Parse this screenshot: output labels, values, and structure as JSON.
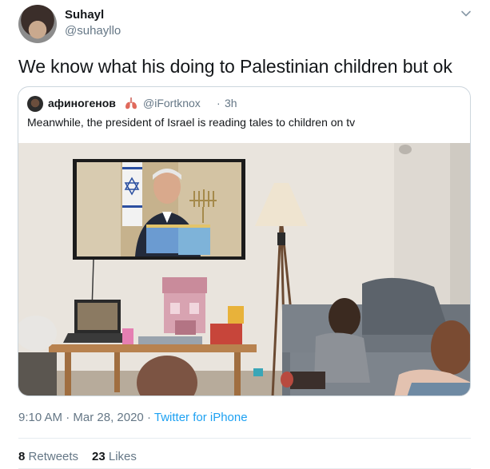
{
  "author": {
    "name": "Suhayl",
    "handle": "@suhayllo"
  },
  "tweet": {
    "text": "We know what his doing to Palestinian children but ok"
  },
  "quoted": {
    "name": "афиногенов",
    "handle": "@iFortknox",
    "separator": "·",
    "time": "3h",
    "text": "Meanwhile, the president of Israel is reading tales to children on tv"
  },
  "meta": {
    "time": "9:10 AM",
    "dot1": "·",
    "date": "Mar 28, 2020",
    "dot2": "·",
    "source": "Twitter for iPhone"
  },
  "stats": {
    "retweets_count": "8",
    "retweets_label": "Retweets",
    "likes_count": "23",
    "likes_label": "Likes"
  },
  "icons": {
    "caret": "chevron-down-icon",
    "emoji": "lungs-emoji-icon"
  }
}
